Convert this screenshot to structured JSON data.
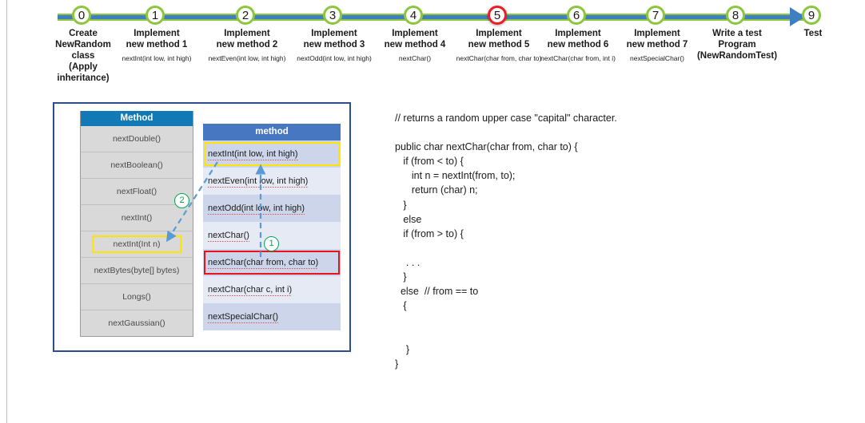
{
  "timeline": {
    "nodes": [
      {
        "num": "0",
        "title": "Create\nNewRandom\nclass\n(Apply\ninheritance)",
        "sub": "",
        "state": "normal"
      },
      {
        "num": "1",
        "title": "Implement\nnew method 1",
        "sub": "nextInt(int low, int high)",
        "state": "normal"
      },
      {
        "num": "2",
        "title": "Implement\nnew method 2",
        "sub": "nextEven(int low, int high)",
        "state": "normal"
      },
      {
        "num": "3",
        "title": "Implement\nnew method 3",
        "sub": "nextOdd(int low, int high)",
        "state": "normal"
      },
      {
        "num": "4",
        "title": "Implement\nnew method 4",
        "sub": "nextChar()",
        "state": "normal"
      },
      {
        "num": "5",
        "title": "Implement\nnew method 5",
        "sub": "nextChar(char from, char to)",
        "state": "alert"
      },
      {
        "num": "6",
        "title": "Implement\nnew method 6",
        "sub": "nextChar(char from, int i)",
        "state": "normal"
      },
      {
        "num": "7",
        "title": "Implement\nnew method 7",
        "sub": "nextSpecialChar()",
        "state": "normal"
      },
      {
        "num": "8",
        "title": "Write a test\nProgram\n(NewRandomTest)",
        "sub": "",
        "state": "normal"
      },
      {
        "num": "9",
        "title": "Test",
        "sub": "",
        "state": "normal"
      }
    ],
    "line_color_primary": "#3f7fc1",
    "line_color_secondary": "#8cc63e",
    "node_color_normal": "#8cc63e",
    "node_color_alert": "#ee1c25"
  },
  "left_table": {
    "header": "Method",
    "header_color": "#1179b5",
    "rows": [
      {
        "label": "nextDouble()",
        "highlight": "none"
      },
      {
        "label": "nextBoolean()",
        "highlight": "none"
      },
      {
        "label": "nextFloat()",
        "highlight": "none"
      },
      {
        "label": "nextInt()",
        "highlight": "none"
      },
      {
        "label": "nextInt(Int n)",
        "highlight": "yellow"
      },
      {
        "label": "nextBytes(byte[] bytes)",
        "highlight": "none"
      },
      {
        "label": "Longs()",
        "highlight": "none"
      },
      {
        "label": "nextGaussian()",
        "highlight": "none"
      }
    ]
  },
  "right_table": {
    "header": "method",
    "header_color": "#4877c2",
    "rows": [
      {
        "label": "nextInt(int low, int high)",
        "highlight": "yellow"
      },
      {
        "label": "nextEven(int low, int high)",
        "highlight": "none"
      },
      {
        "label": "nextOdd(int low, int high)",
        "highlight": "none"
      },
      {
        "label": "nextChar()",
        "highlight": "none"
      },
      {
        "label": "nextChar(char from, char to)",
        "highlight": "red"
      },
      {
        "label": "nextChar(char c, int i)",
        "highlight": "none"
      },
      {
        "label": "nextSpecialChar()",
        "highlight": "none"
      }
    ]
  },
  "annotations": {
    "callout_one": "1",
    "callout_two": "2",
    "callout_color": "#00a651",
    "arrow_color": "#5b9bd5"
  },
  "code": {
    "text": "// returns a random upper case \"capital\" character.\n\npublic char nextChar(char from, char to) {\n   if (from < to) {\n      int n = nextInt(from, to);\n      return (char) n;\n   }\n   else\n   if (from > to) {\n\n    . . .\n   }\n  else  // from == to\n   {\n\n\n    }\n}"
  }
}
